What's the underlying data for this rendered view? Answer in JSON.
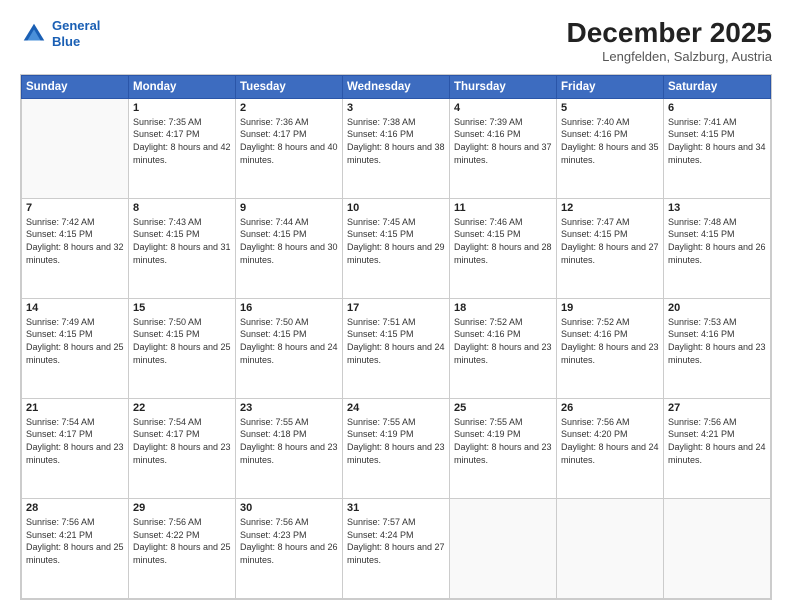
{
  "header": {
    "logo_line1": "General",
    "logo_line2": "Blue",
    "title": "December 2025",
    "subtitle": "Lengfelden, Salzburg, Austria"
  },
  "days_of_week": [
    "Sunday",
    "Monday",
    "Tuesday",
    "Wednesday",
    "Thursday",
    "Friday",
    "Saturday"
  ],
  "weeks": [
    [
      {
        "day": "",
        "info": ""
      },
      {
        "day": "1",
        "info": "Sunrise: 7:35 AM\nSunset: 4:17 PM\nDaylight: 8 hours\nand 42 minutes."
      },
      {
        "day": "2",
        "info": "Sunrise: 7:36 AM\nSunset: 4:17 PM\nDaylight: 8 hours\nand 40 minutes."
      },
      {
        "day": "3",
        "info": "Sunrise: 7:38 AM\nSunset: 4:16 PM\nDaylight: 8 hours\nand 38 minutes."
      },
      {
        "day": "4",
        "info": "Sunrise: 7:39 AM\nSunset: 4:16 PM\nDaylight: 8 hours\nand 37 minutes."
      },
      {
        "day": "5",
        "info": "Sunrise: 7:40 AM\nSunset: 4:16 PM\nDaylight: 8 hours\nand 35 minutes."
      },
      {
        "day": "6",
        "info": "Sunrise: 7:41 AM\nSunset: 4:15 PM\nDaylight: 8 hours\nand 34 minutes."
      }
    ],
    [
      {
        "day": "7",
        "info": "Sunrise: 7:42 AM\nSunset: 4:15 PM\nDaylight: 8 hours\nand 32 minutes."
      },
      {
        "day": "8",
        "info": "Sunrise: 7:43 AM\nSunset: 4:15 PM\nDaylight: 8 hours\nand 31 minutes."
      },
      {
        "day": "9",
        "info": "Sunrise: 7:44 AM\nSunset: 4:15 PM\nDaylight: 8 hours\nand 30 minutes."
      },
      {
        "day": "10",
        "info": "Sunrise: 7:45 AM\nSunset: 4:15 PM\nDaylight: 8 hours\nand 29 minutes."
      },
      {
        "day": "11",
        "info": "Sunrise: 7:46 AM\nSunset: 4:15 PM\nDaylight: 8 hours\nand 28 minutes."
      },
      {
        "day": "12",
        "info": "Sunrise: 7:47 AM\nSunset: 4:15 PM\nDaylight: 8 hours\nand 27 minutes."
      },
      {
        "day": "13",
        "info": "Sunrise: 7:48 AM\nSunset: 4:15 PM\nDaylight: 8 hours\nand 26 minutes."
      }
    ],
    [
      {
        "day": "14",
        "info": "Sunrise: 7:49 AM\nSunset: 4:15 PM\nDaylight: 8 hours\nand 25 minutes."
      },
      {
        "day": "15",
        "info": "Sunrise: 7:50 AM\nSunset: 4:15 PM\nDaylight: 8 hours\nand 25 minutes."
      },
      {
        "day": "16",
        "info": "Sunrise: 7:50 AM\nSunset: 4:15 PM\nDaylight: 8 hours\nand 24 minutes."
      },
      {
        "day": "17",
        "info": "Sunrise: 7:51 AM\nSunset: 4:15 PM\nDaylight: 8 hours\nand 24 minutes."
      },
      {
        "day": "18",
        "info": "Sunrise: 7:52 AM\nSunset: 4:16 PM\nDaylight: 8 hours\nand 23 minutes."
      },
      {
        "day": "19",
        "info": "Sunrise: 7:52 AM\nSunset: 4:16 PM\nDaylight: 8 hours\nand 23 minutes."
      },
      {
        "day": "20",
        "info": "Sunrise: 7:53 AM\nSunset: 4:16 PM\nDaylight: 8 hours\nand 23 minutes."
      }
    ],
    [
      {
        "day": "21",
        "info": "Sunrise: 7:54 AM\nSunset: 4:17 PM\nDaylight: 8 hours\nand 23 minutes."
      },
      {
        "day": "22",
        "info": "Sunrise: 7:54 AM\nSunset: 4:17 PM\nDaylight: 8 hours\nand 23 minutes."
      },
      {
        "day": "23",
        "info": "Sunrise: 7:55 AM\nSunset: 4:18 PM\nDaylight: 8 hours\nand 23 minutes."
      },
      {
        "day": "24",
        "info": "Sunrise: 7:55 AM\nSunset: 4:19 PM\nDaylight: 8 hours\nand 23 minutes."
      },
      {
        "day": "25",
        "info": "Sunrise: 7:55 AM\nSunset: 4:19 PM\nDaylight: 8 hours\nand 23 minutes."
      },
      {
        "day": "26",
        "info": "Sunrise: 7:56 AM\nSunset: 4:20 PM\nDaylight: 8 hours\nand 24 minutes."
      },
      {
        "day": "27",
        "info": "Sunrise: 7:56 AM\nSunset: 4:21 PM\nDaylight: 8 hours\nand 24 minutes."
      }
    ],
    [
      {
        "day": "28",
        "info": "Sunrise: 7:56 AM\nSunset: 4:21 PM\nDaylight: 8 hours\nand 25 minutes."
      },
      {
        "day": "29",
        "info": "Sunrise: 7:56 AM\nSunset: 4:22 PM\nDaylight: 8 hours\nand 25 minutes."
      },
      {
        "day": "30",
        "info": "Sunrise: 7:56 AM\nSunset: 4:23 PM\nDaylight: 8 hours\nand 26 minutes."
      },
      {
        "day": "31",
        "info": "Sunrise: 7:57 AM\nSunset: 4:24 PM\nDaylight: 8 hours\nand 27 minutes."
      },
      {
        "day": "",
        "info": ""
      },
      {
        "day": "",
        "info": ""
      },
      {
        "day": "",
        "info": ""
      }
    ]
  ]
}
